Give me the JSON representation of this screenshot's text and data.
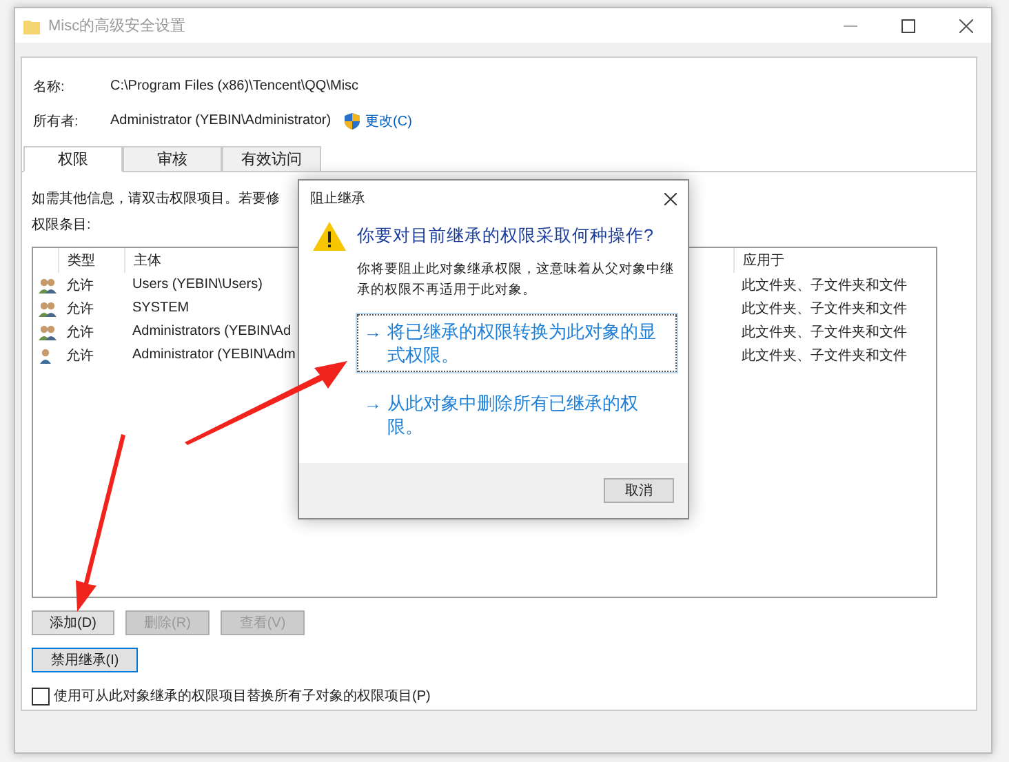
{
  "window": {
    "title": "Misc的高级安全设置"
  },
  "name": {
    "label": "名称:",
    "value": "C:\\Program Files (x86)\\Tencent\\QQ\\Misc"
  },
  "owner": {
    "label": "所有者:",
    "value": "Administrator (YEBIN\\Administrator)",
    "change_link": "更改(C)"
  },
  "tabs": [
    {
      "label": "权限",
      "selected": true
    },
    {
      "label": "审核",
      "selected": false
    },
    {
      "label": "有效访问",
      "selected": false
    }
  ],
  "info_text": "如需其他信息，请双击权限项目。若要修",
  "entries_label": "权限条目:",
  "table": {
    "columns": [
      "类型",
      "主体",
      "应用于"
    ],
    "rows": [
      {
        "kind": "group",
        "type": "允许",
        "principal": "Users (YEBIN\\Users)",
        "applies_to": "此文件夹、子文件夹和文件"
      },
      {
        "kind": "group",
        "type": "允许",
        "principal": "SYSTEM",
        "applies_to": "此文件夹、子文件夹和文件"
      },
      {
        "kind": "group",
        "type": "允许",
        "principal": "Administrators (YEBIN\\Ad",
        "applies_to": "此文件夹、子文件夹和文件"
      },
      {
        "kind": "user",
        "type": "允许",
        "principal": "Administrator (YEBIN\\Adm",
        "applies_to": "此文件夹、子文件夹和文件"
      }
    ]
  },
  "buttons": [
    {
      "label": "添加(D)",
      "disabled": false
    },
    {
      "label": "删除(R)",
      "disabled": true
    },
    {
      "label": "查看(V)",
      "disabled": true
    }
  ],
  "inheritance_button": "禁用继承(I)",
  "replace_checkbox": {
    "label": "使用可从此对象继承的权限项目替换所有子对象的权限项目(P)",
    "checked": false
  },
  "dialog": {
    "title": "阻止继承",
    "heading": "你要对目前继承的权限采取何种操作?",
    "description": "你将要阻止此对象继承权限，这意味着从父对象中继承的权限不再适用于此对象。",
    "options": [
      {
        "arrow": "→",
        "label": "将已继承的权限转换为此对象的显式权限。",
        "focused": true
      },
      {
        "arrow": "→",
        "label": "从此对象中删除所有已继承的权限。",
        "focused": false
      }
    ],
    "cancel": "取消"
  }
}
